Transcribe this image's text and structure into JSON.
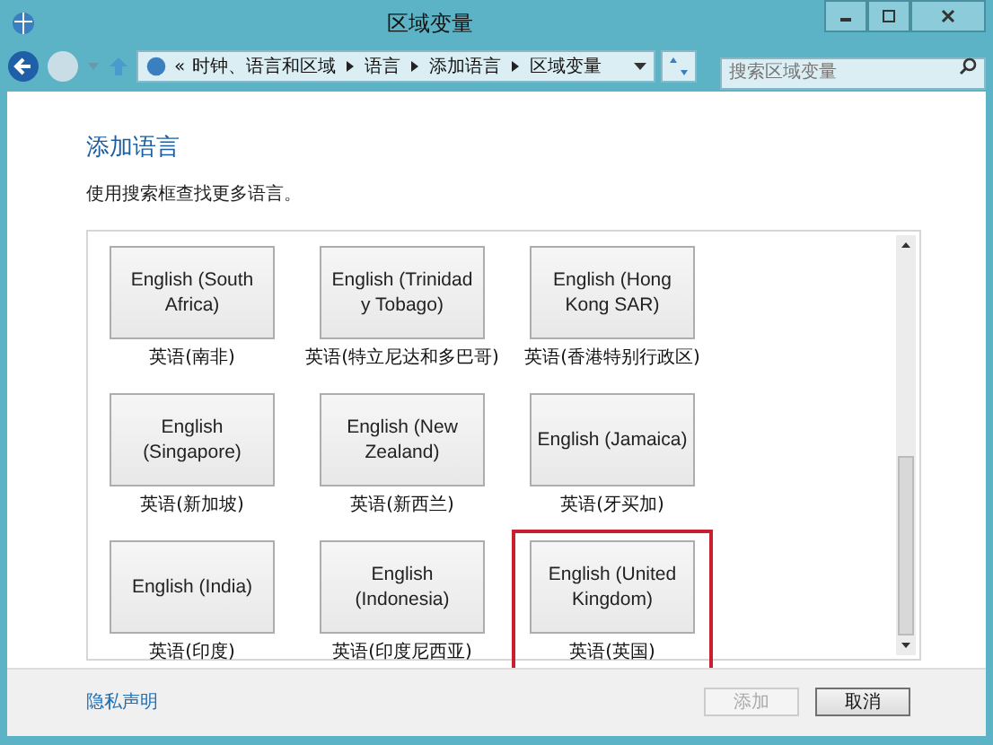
{
  "window": {
    "title": "区域变量"
  },
  "address_bar": {
    "overflow": "«",
    "crumbs": [
      "时钟、语言和区域",
      "语言",
      "添加语言",
      "区域变量"
    ]
  },
  "search": {
    "placeholder": "搜索区域变量"
  },
  "heading": "添加语言",
  "hint": "使用搜索框查找更多语言。",
  "languages": [
    {
      "name": "English (South Africa)",
      "label": "英语(南非)",
      "highlighted": false
    },
    {
      "name": "English (Trinidad y Tobago)",
      "label": "英语(特立尼达和多巴哥)",
      "highlighted": false
    },
    {
      "name": "English (Hong Kong SAR)",
      "label": "英语(香港特别行政区)",
      "highlighted": false
    },
    {
      "name": "English (Singapore)",
      "label": "英语(新加坡)",
      "highlighted": false
    },
    {
      "name": "English (New Zealand)",
      "label": "英语(新西兰)",
      "highlighted": false
    },
    {
      "name": "English (Jamaica)",
      "label": "英语(牙买加)",
      "highlighted": false
    },
    {
      "name": "English (India)",
      "label": "英语(印度)",
      "highlighted": false
    },
    {
      "name": "English (Indonesia)",
      "label": "英语(印度尼西亚)",
      "highlighted": false
    },
    {
      "name": "English (United Kingdom)",
      "label": "英语(英国)",
      "highlighted": true
    }
  ],
  "footer": {
    "link": "隐私声明",
    "buttons": [
      {
        "label": "添加",
        "disabled": true
      },
      {
        "label": "取消",
        "disabled": false
      }
    ]
  }
}
